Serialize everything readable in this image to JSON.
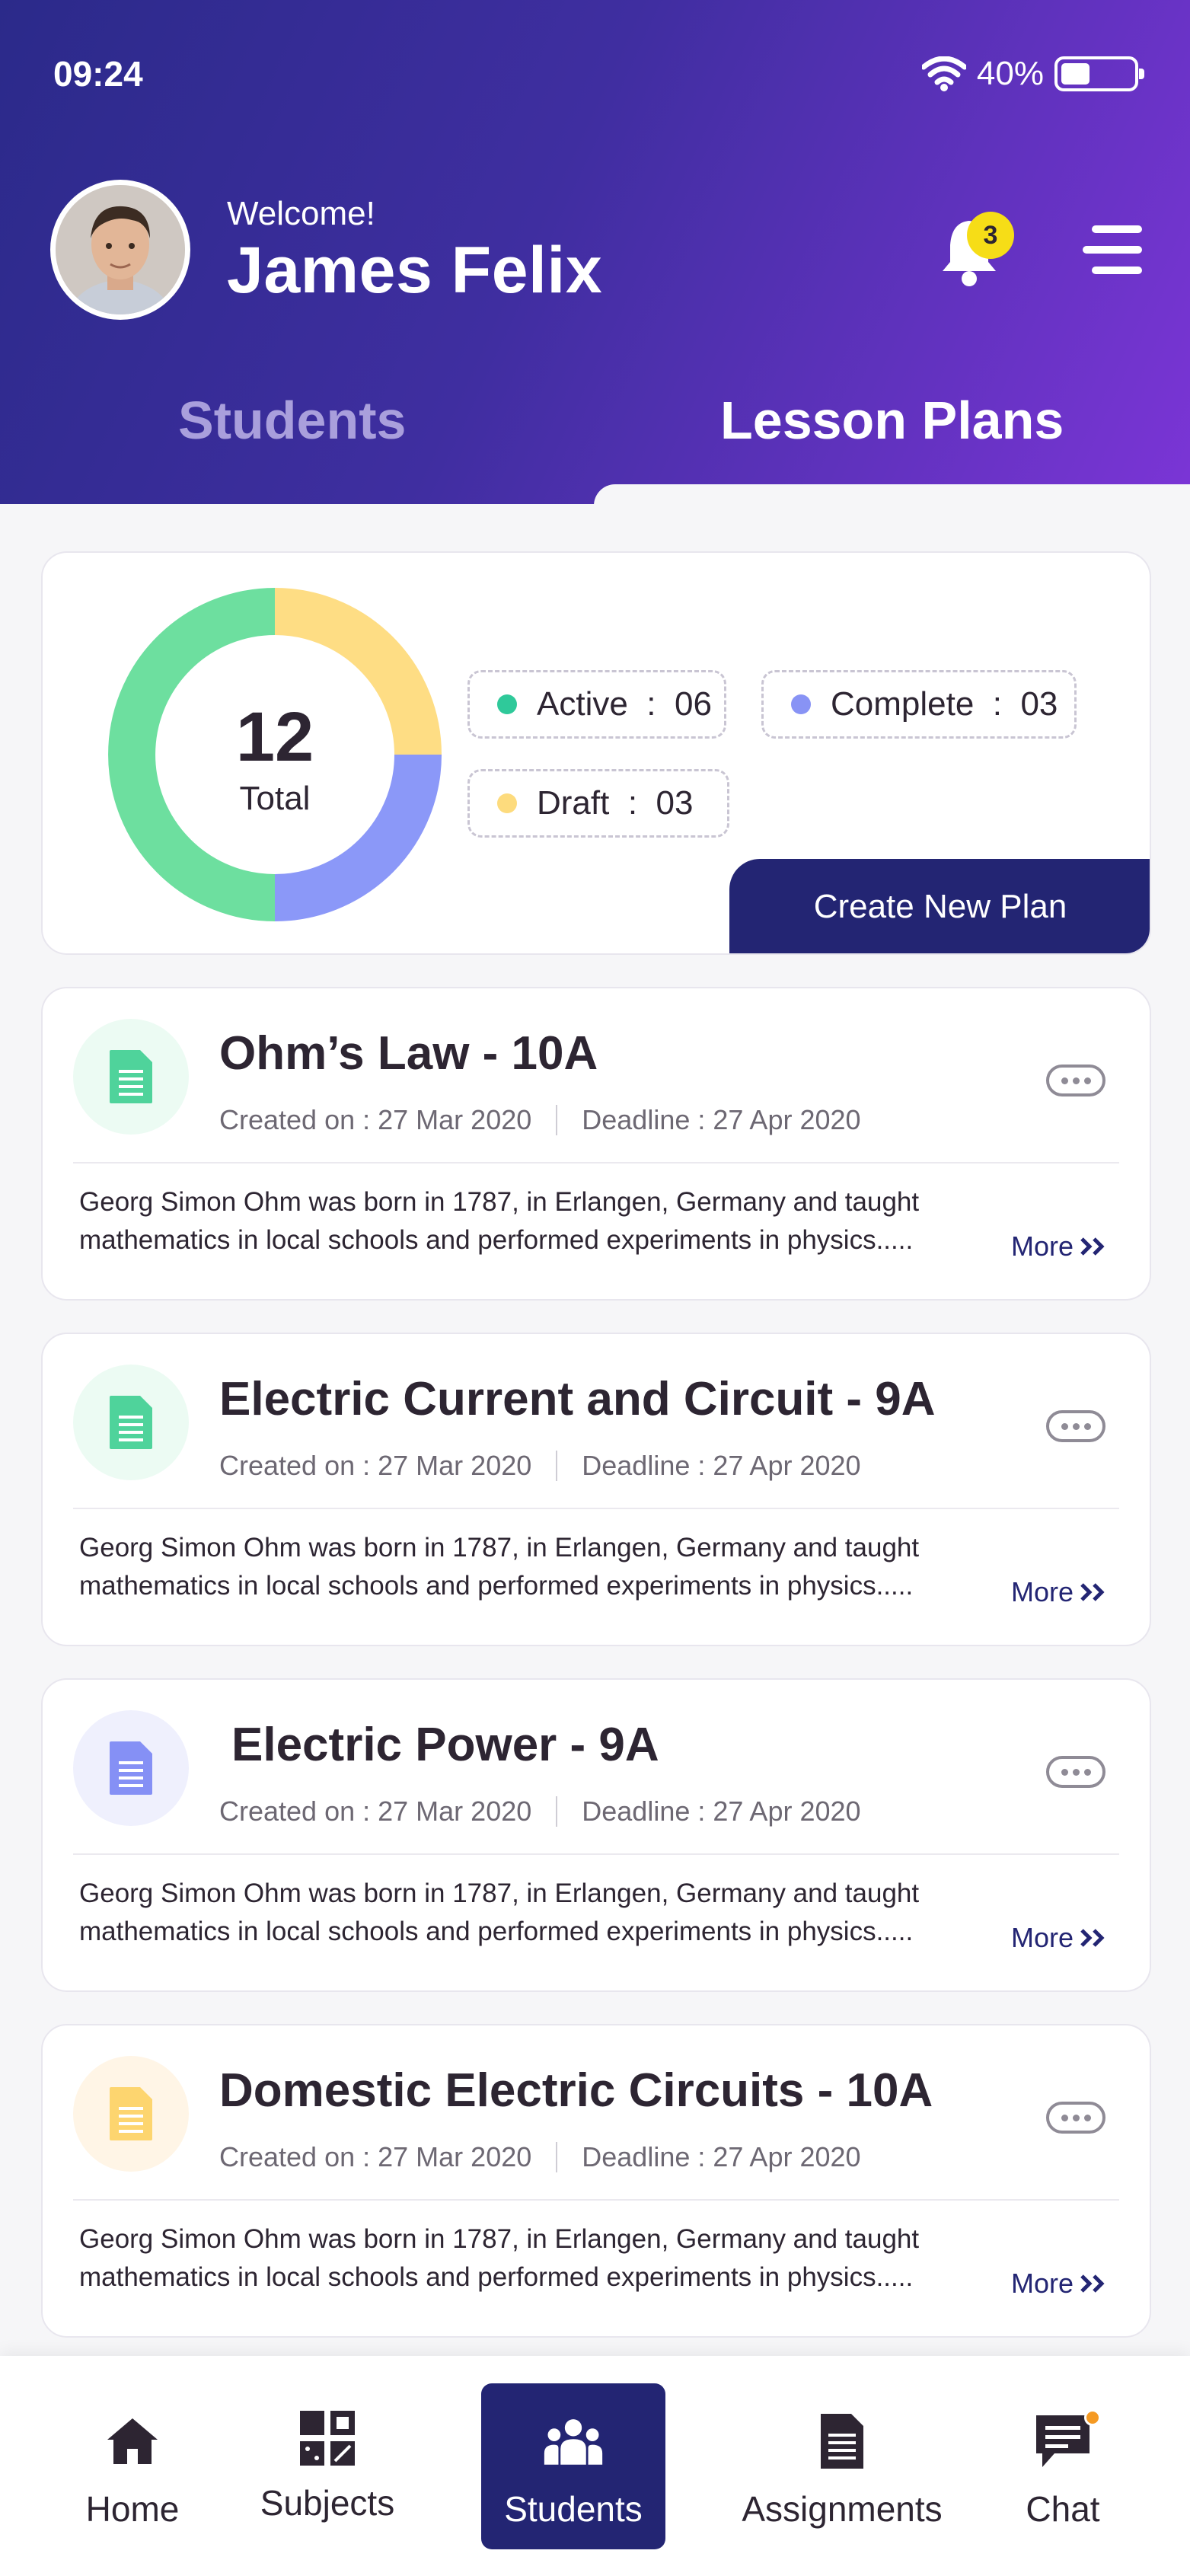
{
  "status_bar": {
    "time": "09:24",
    "battery": "40%",
    "battery_level": 0.4
  },
  "header": {
    "welcome": "Welcome!",
    "user_name": "James Felix",
    "notification_count": "3",
    "tabs": [
      {
        "label": "Students",
        "active": false
      },
      {
        "label": "Lesson Plans",
        "active": true
      }
    ]
  },
  "summary": {
    "total_value": "12",
    "total_label": "Total",
    "stats": [
      {
        "label": "Active",
        "sep": ":",
        "value": "06",
        "color": "#2fc99a"
      },
      {
        "label": "Complete",
        "sep": ":",
        "value": "03",
        "color": "#8893f5"
      },
      {
        "label": "Draft",
        "sep": ":",
        "value": "03",
        "color": "#fddb7d"
      }
    ],
    "create_button": "Create New Plan",
    "chart_colors": {
      "active": "#6ddf9f",
      "complete": "#8b98f8",
      "draft": "#fedd84"
    }
  },
  "lessons": [
    {
      "title": "Ohm’s Law - 10A",
      "created": "Created on : 27 Mar 2020",
      "deadline": "Deadline : 27 Apr 2020",
      "description": "Georg Simon Ohm was born in 1787, in Erlangen, Germany and taught mathematics in local schools and performed experiments in physics.....",
      "more": "More",
      "icon_color": "#4fd39b",
      "icon_bg": "#ecfbf3"
    },
    {
      "title": "Electric Current and Circuit - 9A",
      "created": "Created on : 27 Mar 2020",
      "deadline": "Deadline : 27 Apr 2020",
      "description": "Georg Simon Ohm was born in 1787, in Erlangen, Germany and taught mathematics in local schools and performed experiments in physics.....",
      "more": "More",
      "icon_color": "#4fd39b",
      "icon_bg": "#ecfbf3"
    },
    {
      "title": "Electric Power - 9A",
      "created": "Created on : 27 Mar 2020",
      "deadline": "Deadline : 27 Apr 2020",
      "description": "Georg Simon Ohm was born in 1787, in Erlangen, Germany and taught mathematics in local schools and performed experiments in physics.....",
      "more": "More",
      "icon_color": "#8590f5",
      "icon_bg": "#eff0fd"
    },
    {
      "title": "Domestic Electric Circuits - 10A",
      "created": "Created on : 27 Mar 2020",
      "deadline": "Deadline : 27 Apr 2020",
      "description": "Georg Simon Ohm was born in 1787, in Erlangen, Germany and taught mathematics in local schools and performed experiments in physics.....",
      "more": "More",
      "icon_color": "#fdd56f",
      "icon_bg": "#fff5e6"
    }
  ],
  "bottom_nav": [
    {
      "label": "Home",
      "icon": "home-icon"
    },
    {
      "label": "Subjects",
      "icon": "subjects-icon"
    },
    {
      "label": "Students",
      "icon": "students-icon",
      "active": true
    },
    {
      "label": "Assignments",
      "icon": "assignments-icon"
    },
    {
      "label": "Chat",
      "icon": "chat-icon"
    }
  ]
}
